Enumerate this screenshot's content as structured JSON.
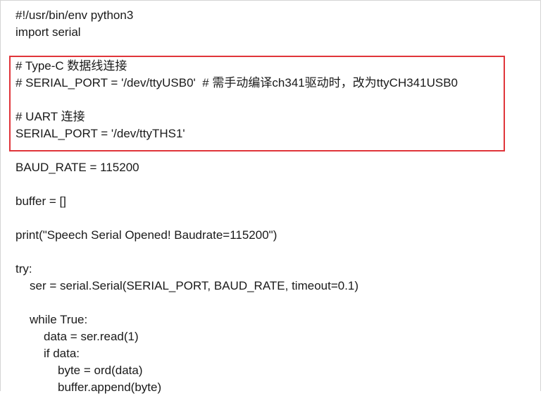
{
  "code": {
    "lines": [
      {
        "text": "#!/usr/bin/env python3",
        "indent": 0
      },
      {
        "text": "import serial",
        "indent": 0
      },
      {
        "text": "",
        "indent": 0
      },
      {
        "text": "# Type-C 数据线连接",
        "indent": 0
      },
      {
        "text": "# SERIAL_PORT = '/dev/ttyUSB0'  # 需手动编译ch341驱动时，改为ttyCH341USB0",
        "indent": 0
      },
      {
        "text": "",
        "indent": 0
      },
      {
        "text": "# UART 连接",
        "indent": 0
      },
      {
        "text": "SERIAL_PORT = '/dev/ttyTHS1'",
        "indent": 0
      },
      {
        "text": "",
        "indent": 0
      },
      {
        "text": "BAUD_RATE = 115200",
        "indent": 0
      },
      {
        "text": "",
        "indent": 0
      },
      {
        "text": "buffer = []",
        "indent": 0
      },
      {
        "text": "",
        "indent": 0
      },
      {
        "text": "print(\"Speech Serial Opened! Baudrate=115200\")",
        "indent": 0
      },
      {
        "text": "",
        "indent": 0
      },
      {
        "text": "try:",
        "indent": 0
      },
      {
        "text": "ser = serial.Serial(SERIAL_PORT, BAUD_RATE, timeout=0.1)",
        "indent": 1
      },
      {
        "text": "",
        "indent": 0
      },
      {
        "text": "while True:",
        "indent": 1
      },
      {
        "text": "data = ser.read(1)",
        "indent": 2
      },
      {
        "text": "if data:",
        "indent": 2
      },
      {
        "text": "byte = ord(data)",
        "indent": 3
      },
      {
        "text": "buffer.append(byte)",
        "indent": 3
      }
    ]
  },
  "highlight": {
    "color": "#e0353a"
  }
}
